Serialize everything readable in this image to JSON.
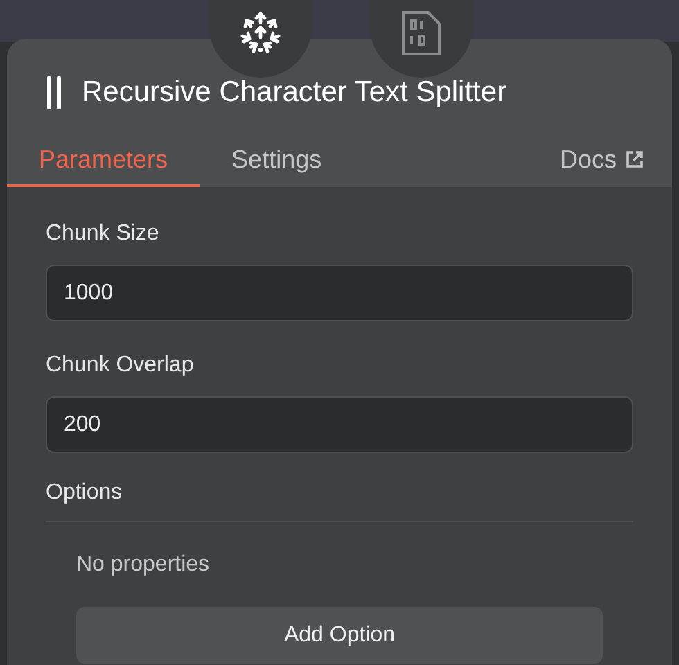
{
  "node": {
    "title": "Recursive Character Text Splitter"
  },
  "tabs": [
    {
      "label": "Parameters",
      "selected": true
    },
    {
      "label": "Settings",
      "selected": false
    }
  ],
  "docs_link": {
    "label": "Docs"
  },
  "fields": [
    {
      "label": "Chunk Size",
      "value": "1000"
    },
    {
      "label": "Chunk Overlap",
      "value": "200"
    }
  ],
  "options": {
    "title": "Options",
    "empty_text": "No properties",
    "button": "Add Option"
  }
}
